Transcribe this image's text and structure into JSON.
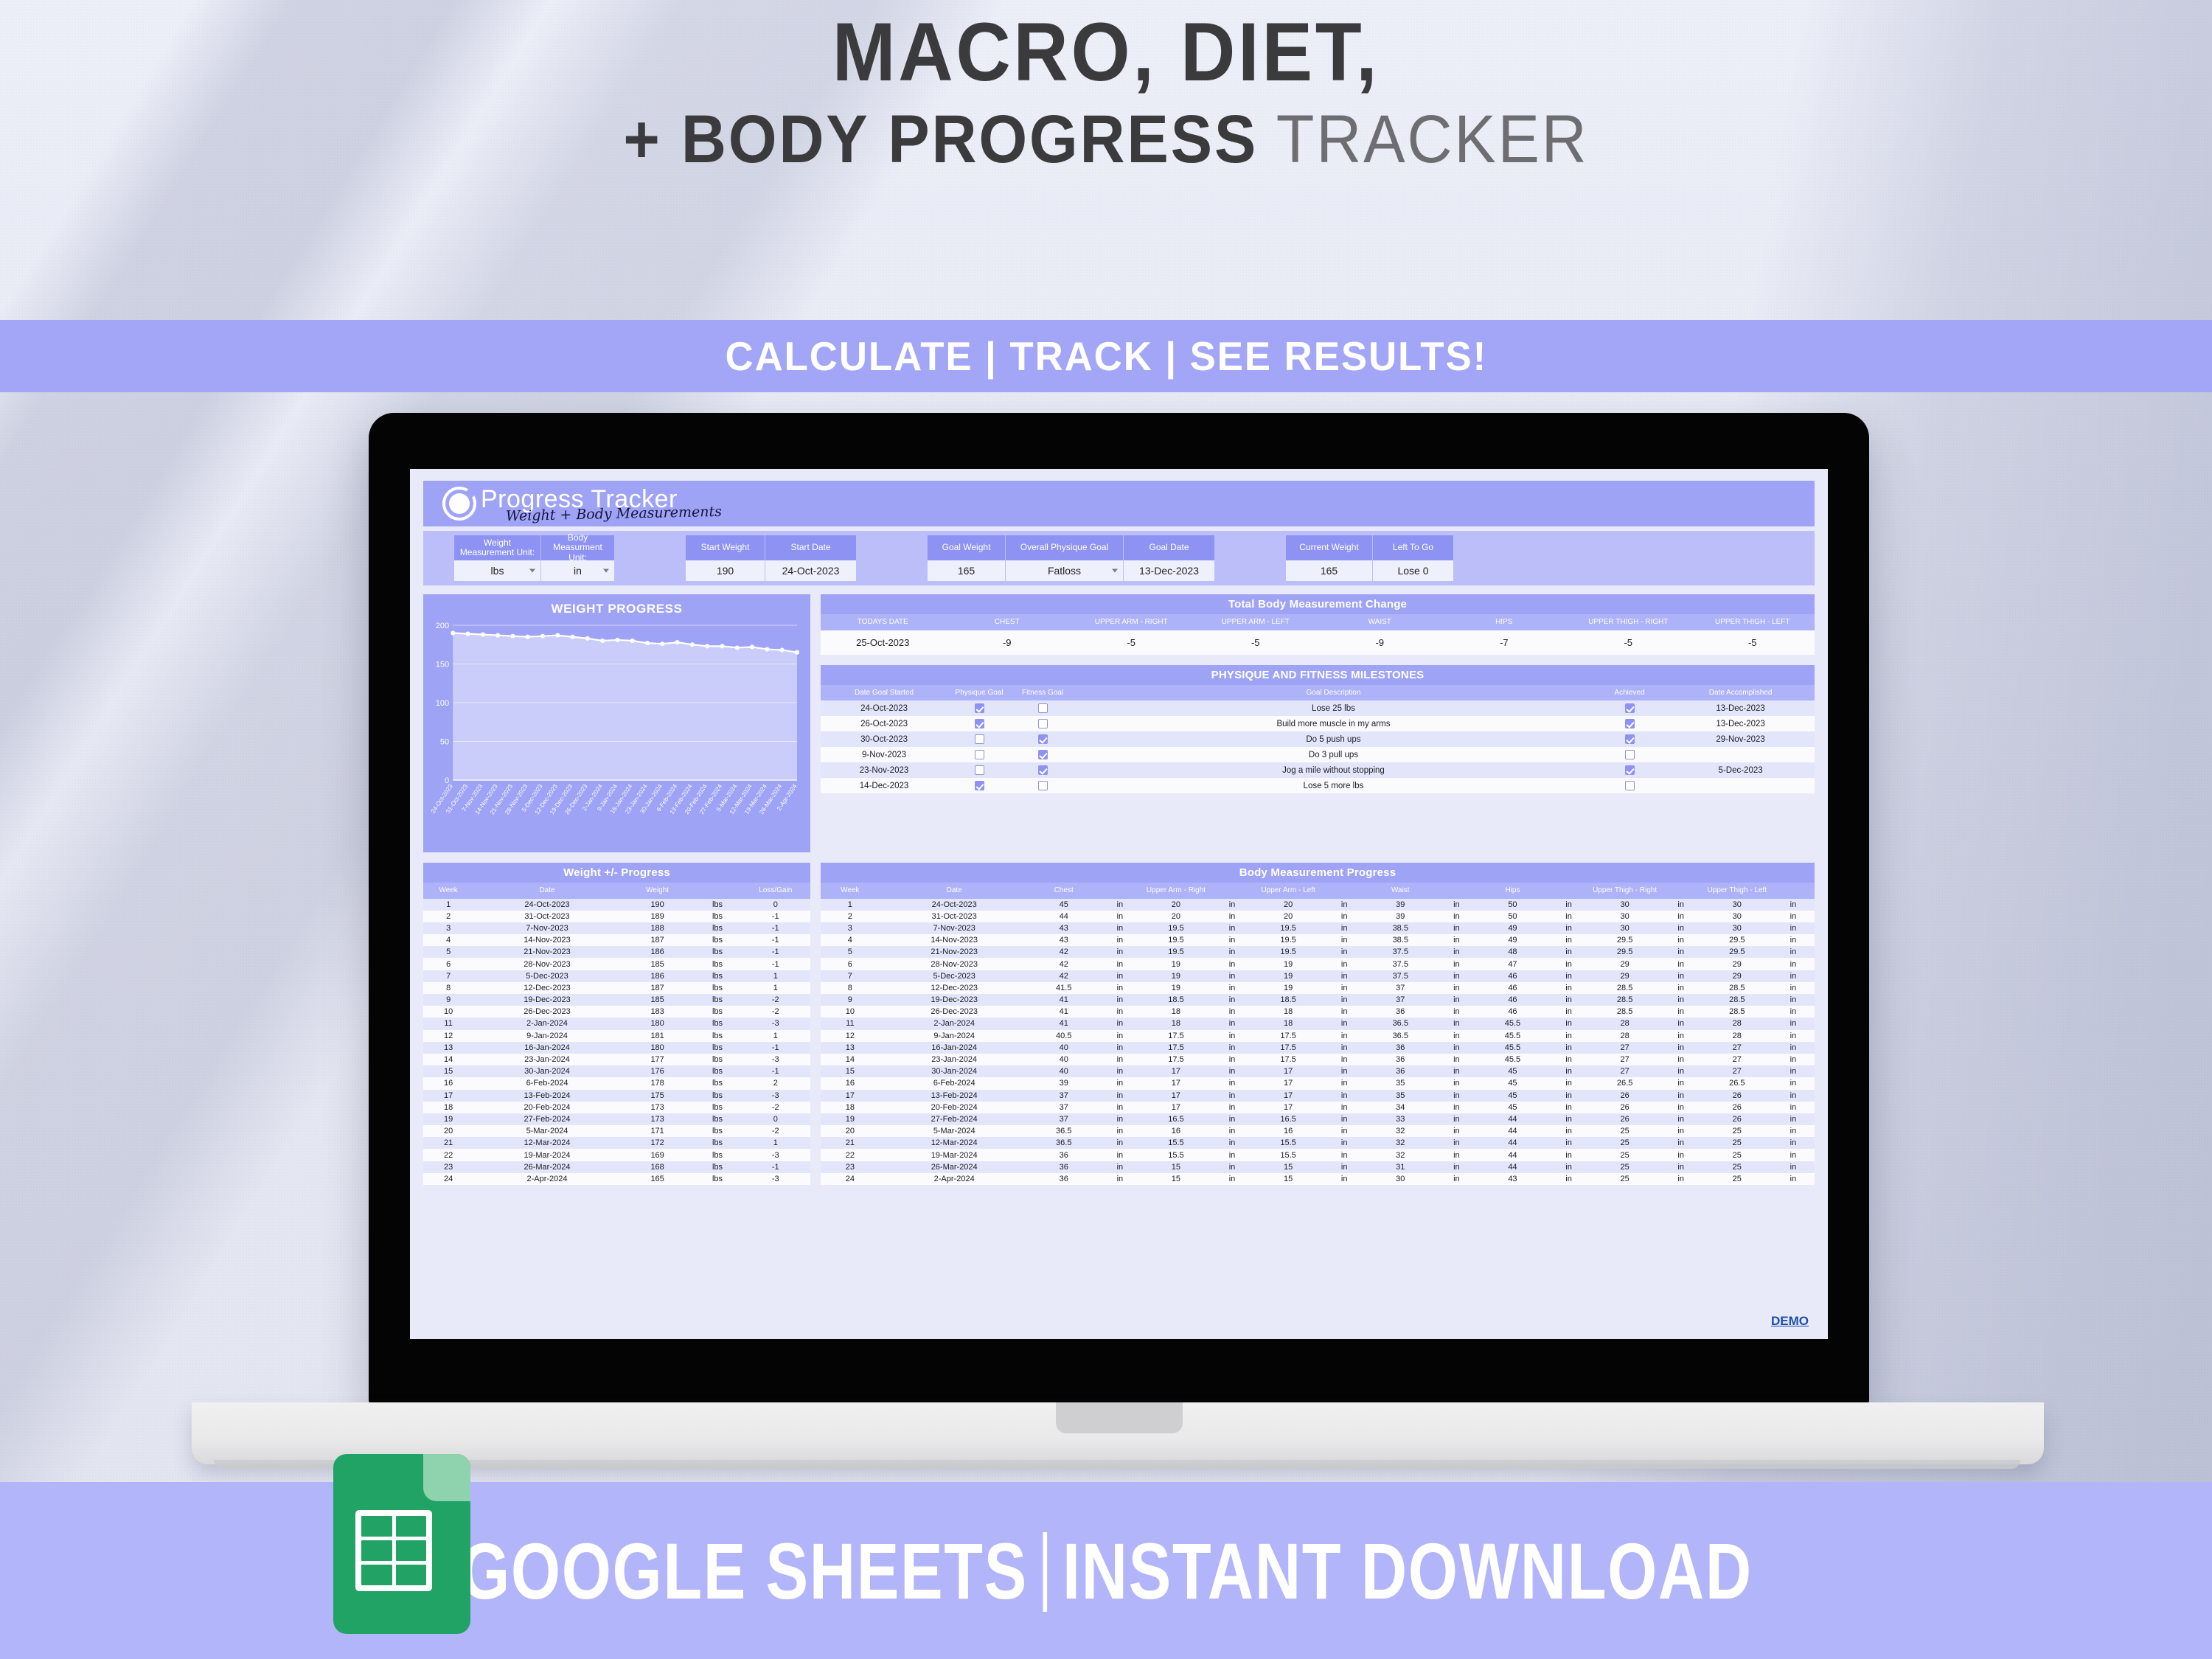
{
  "headline": {
    "line1": "MACRO, DIET,",
    "line2_bold": "+ BODY PROGRESS",
    "line2_light": "TRACKER"
  },
  "sub_banner": {
    "text": "CALCULATE | TRACK | SEE RESULTS!"
  },
  "bottom_banner": {
    "left": "GOOGLE SHEETS",
    "right": "INSTANT DOWNLOAD",
    "icon": "google-sheets-icon"
  },
  "colors": {
    "accent_purple": "#9fa3f6",
    "banner_purple": "#a3a5f7",
    "bottom_banner_purple": "#b3b5fa",
    "panel_bg": "#e8eaf9",
    "row_alt": "#e3e5fb",
    "sheets_green": "#21a366",
    "headline_dark": "#3b3b3d",
    "headline_light": "#6e6e72"
  },
  "sheet": {
    "brand": "Progress Tracker",
    "brand_sub": "Weight + Body Measurements",
    "demo_label": "DEMO",
    "controls": [
      {
        "cells": [
          {
            "header": "Weight Measurement Unit:",
            "value": "lbs",
            "dropdown": true,
            "w": 118
          },
          {
            "header": "Body Measurment Unit:",
            "value": "in",
            "dropdown": true,
            "w": 100
          }
        ]
      },
      {
        "cells": [
          {
            "header": "Start Weight",
            "value": "190",
            "dropdown": false,
            "w": 108
          },
          {
            "header": "Start Date",
            "value": "24-Oct-2023",
            "dropdown": false,
            "w": 124
          }
        ]
      },
      {
        "cells": [
          {
            "header": "Goal Weight",
            "value": "165",
            "dropdown": false,
            "w": 106
          },
          {
            "header": "Overall Physique Goal",
            "value": "Fatloss",
            "dropdown": true,
            "w": 160
          },
          {
            "header": "Goal Date",
            "value": "13-Dec-2023",
            "dropdown": false,
            "w": 124
          }
        ]
      },
      {
        "cells": [
          {
            "header": "Current Weight",
            "value": "165",
            "dropdown": false,
            "w": 118
          },
          {
            "header": "Left To Go",
            "value": "Lose 0",
            "dropdown": false,
            "w": 110
          }
        ]
      }
    ],
    "total_change": {
      "title": "Total Body Measurement Change",
      "headers": [
        "TODAYS DATE",
        "CHEST",
        "UPPER ARM - RIGHT",
        "UPPER ARM - LEFT",
        "WAIST",
        "HIPS",
        "UPPER THIGH - RIGHT",
        "UPPER THIGH - LEFT"
      ],
      "row": [
        "25-Oct-2023",
        "-9",
        "-5",
        "-5",
        "-9",
        "-7",
        "-5",
        "-5"
      ]
    },
    "milestones": {
      "title": "PHYSIQUE AND FITNESS MILESTONES",
      "headers": [
        "Date Goal Started",
        "Physique Goal",
        "Fitness Goal",
        "Goal Description",
        "Achieved",
        "Date Accomplished"
      ],
      "rows": [
        {
          "date_started": "24-Oct-2023",
          "physique": true,
          "fitness": false,
          "description": "Lose 25 lbs",
          "achieved": true,
          "date_accomplished": "13-Dec-2023"
        },
        {
          "date_started": "26-Oct-2023",
          "physique": true,
          "fitness": false,
          "description": "Build more muscle in my arms",
          "achieved": true,
          "date_accomplished": "13-Dec-2023"
        },
        {
          "date_started": "30-Oct-2023",
          "physique": false,
          "fitness": true,
          "description": "Do 5 push ups",
          "achieved": true,
          "date_accomplished": "29-Nov-2023"
        },
        {
          "date_started": "9-Nov-2023",
          "physique": false,
          "fitness": true,
          "description": "Do 3 pull ups",
          "achieved": false,
          "date_accomplished": ""
        },
        {
          "date_started": "23-Nov-2023",
          "physique": false,
          "fitness": true,
          "description": "Jog a mile without stopping",
          "achieved": true,
          "date_accomplished": "5-Dec-2023"
        },
        {
          "date_started": "14-Dec-2023",
          "physique": true,
          "fitness": false,
          "description": "Lose 5 more lbs",
          "achieved": false,
          "date_accomplished": ""
        }
      ]
    },
    "weight_progress_table": {
      "title": "Weight +/- Progress",
      "headers": [
        "Week",
        "Date",
        "Weight",
        "",
        "Loss/Gain"
      ],
      "rows": [
        [
          "1",
          "24-Oct-2023",
          "190",
          "lbs",
          "0"
        ],
        [
          "2",
          "31-Oct-2023",
          "189",
          "lbs",
          "-1"
        ],
        [
          "3",
          "7-Nov-2023",
          "188",
          "lbs",
          "-1"
        ],
        [
          "4",
          "14-Nov-2023",
          "187",
          "lbs",
          "-1"
        ],
        [
          "5",
          "21-Nov-2023",
          "186",
          "lbs",
          "-1"
        ],
        [
          "6",
          "28-Nov-2023",
          "185",
          "lbs",
          "-1"
        ],
        [
          "7",
          "5-Dec-2023",
          "186",
          "lbs",
          "1"
        ],
        [
          "8",
          "12-Dec-2023",
          "187",
          "lbs",
          "1"
        ],
        [
          "9",
          "19-Dec-2023",
          "185",
          "lbs",
          "-2"
        ],
        [
          "10",
          "26-Dec-2023",
          "183",
          "lbs",
          "-2"
        ],
        [
          "11",
          "2-Jan-2024",
          "180",
          "lbs",
          "-3"
        ],
        [
          "12",
          "9-Jan-2024",
          "181",
          "lbs",
          "1"
        ],
        [
          "13",
          "16-Jan-2024",
          "180",
          "lbs",
          "-1"
        ],
        [
          "14",
          "23-Jan-2024",
          "177",
          "lbs",
          "-3"
        ],
        [
          "15",
          "30-Jan-2024",
          "176",
          "lbs",
          "-1"
        ],
        [
          "16",
          "6-Feb-2024",
          "178",
          "lbs",
          "2"
        ],
        [
          "17",
          "13-Feb-2024",
          "175",
          "lbs",
          "-3"
        ],
        [
          "18",
          "20-Feb-2024",
          "173",
          "lbs",
          "-2"
        ],
        [
          "19",
          "27-Feb-2024",
          "173",
          "lbs",
          "0"
        ],
        [
          "20",
          "5-Mar-2024",
          "171",
          "lbs",
          "-2"
        ],
        [
          "21",
          "12-Mar-2024",
          "172",
          "lbs",
          "1"
        ],
        [
          "22",
          "19-Mar-2024",
          "169",
          "lbs",
          "-3"
        ],
        [
          "23",
          "26-Mar-2024",
          "168",
          "lbs",
          "-1"
        ],
        [
          "24",
          "2-Apr-2024",
          "165",
          "lbs",
          "-3"
        ]
      ]
    },
    "body_measurement_table": {
      "title": "Body Measurement Progress",
      "headers": [
        "Week",
        "Date",
        "Chest",
        "",
        "Upper Arm - Right",
        "",
        "Upper Arm - Left",
        "",
        "Waist",
        "",
        "Hips",
        "",
        "Upper Thigh - Right",
        "",
        "Upper Thigh - Left",
        ""
      ],
      "rows": [
        [
          "1",
          "24-Oct-2023",
          "45",
          "in",
          "20",
          "in",
          "20",
          "in",
          "39",
          "in",
          "50",
          "in",
          "30",
          "in",
          "30",
          "in"
        ],
        [
          "2",
          "31-Oct-2023",
          "44",
          "in",
          "20",
          "in",
          "20",
          "in",
          "39",
          "in",
          "50",
          "in",
          "30",
          "in",
          "30",
          "in"
        ],
        [
          "3",
          "7-Nov-2023",
          "43",
          "in",
          "19.5",
          "in",
          "19.5",
          "in",
          "38.5",
          "in",
          "49",
          "in",
          "30",
          "in",
          "30",
          "in"
        ],
        [
          "4",
          "14-Nov-2023",
          "43",
          "in",
          "19.5",
          "in",
          "19.5",
          "in",
          "38.5",
          "in",
          "49",
          "in",
          "29.5",
          "in",
          "29.5",
          "in"
        ],
        [
          "5",
          "21-Nov-2023",
          "42",
          "in",
          "19.5",
          "in",
          "19.5",
          "in",
          "37.5",
          "in",
          "48",
          "in",
          "29.5",
          "in",
          "29.5",
          "in"
        ],
        [
          "6",
          "28-Nov-2023",
          "42",
          "in",
          "19",
          "in",
          "19",
          "in",
          "37.5",
          "in",
          "47",
          "in",
          "29",
          "in",
          "29",
          "in"
        ],
        [
          "7",
          "5-Dec-2023",
          "42",
          "in",
          "19",
          "in",
          "19",
          "in",
          "37.5",
          "in",
          "46",
          "in",
          "29",
          "in",
          "29",
          "in"
        ],
        [
          "8",
          "12-Dec-2023",
          "41.5",
          "in",
          "19",
          "in",
          "19",
          "in",
          "37",
          "in",
          "46",
          "in",
          "28.5",
          "in",
          "28.5",
          "in"
        ],
        [
          "9",
          "19-Dec-2023",
          "41",
          "in",
          "18.5",
          "in",
          "18.5",
          "in",
          "37",
          "in",
          "46",
          "in",
          "28.5",
          "in",
          "28.5",
          "in"
        ],
        [
          "10",
          "26-Dec-2023",
          "41",
          "in",
          "18",
          "in",
          "18",
          "in",
          "36",
          "in",
          "46",
          "in",
          "28.5",
          "in",
          "28.5",
          "in"
        ],
        [
          "11",
          "2-Jan-2024",
          "41",
          "in",
          "18",
          "in",
          "18",
          "in",
          "36.5",
          "in",
          "45.5",
          "in",
          "28",
          "in",
          "28",
          "in"
        ],
        [
          "12",
          "9-Jan-2024",
          "40.5",
          "in",
          "17.5",
          "in",
          "17.5",
          "in",
          "36.5",
          "in",
          "45.5",
          "in",
          "28",
          "in",
          "28",
          "in"
        ],
        [
          "13",
          "16-Jan-2024",
          "40",
          "in",
          "17.5",
          "in",
          "17.5",
          "in",
          "36",
          "in",
          "45.5",
          "in",
          "27",
          "in",
          "27",
          "in"
        ],
        [
          "14",
          "23-Jan-2024",
          "40",
          "in",
          "17.5",
          "in",
          "17.5",
          "in",
          "36",
          "in",
          "45.5",
          "in",
          "27",
          "in",
          "27",
          "in"
        ],
        [
          "15",
          "30-Jan-2024",
          "40",
          "in",
          "17",
          "in",
          "17",
          "in",
          "36",
          "in",
          "45",
          "in",
          "27",
          "in",
          "27",
          "in"
        ],
        [
          "16",
          "6-Feb-2024",
          "39",
          "in",
          "17",
          "in",
          "17",
          "in",
          "35",
          "in",
          "45",
          "in",
          "26.5",
          "in",
          "26.5",
          "in"
        ],
        [
          "17",
          "13-Feb-2024",
          "37",
          "in",
          "17",
          "in",
          "17",
          "in",
          "35",
          "in",
          "45",
          "in",
          "26",
          "in",
          "26",
          "in"
        ],
        [
          "18",
          "20-Feb-2024",
          "37",
          "in",
          "17",
          "in",
          "17",
          "in",
          "34",
          "in",
          "45",
          "in",
          "26",
          "in",
          "26",
          "in"
        ],
        [
          "19",
          "27-Feb-2024",
          "37",
          "in",
          "16.5",
          "in",
          "16.5",
          "in",
          "33",
          "in",
          "44",
          "in",
          "26",
          "in",
          "26",
          "in"
        ],
        [
          "20",
          "5-Mar-2024",
          "36.5",
          "in",
          "16",
          "in",
          "16",
          "in",
          "32",
          "in",
          "44",
          "in",
          "25",
          "in",
          "25",
          "in"
        ],
        [
          "21",
          "12-Mar-2024",
          "36.5",
          "in",
          "15.5",
          "in",
          "15.5",
          "in",
          "32",
          "in",
          "44",
          "in",
          "25",
          "in",
          "25",
          "in"
        ],
        [
          "22",
          "19-Mar-2024",
          "36",
          "in",
          "15.5",
          "in",
          "15.5",
          "in",
          "32",
          "in",
          "44",
          "in",
          "25",
          "in",
          "25",
          "in"
        ],
        [
          "23",
          "26-Mar-2024",
          "36",
          "in",
          "15",
          "in",
          "15",
          "in",
          "31",
          "in",
          "44",
          "in",
          "25",
          "in",
          "25",
          "in"
        ],
        [
          "24",
          "2-Apr-2024",
          "36",
          "in",
          "15",
          "in",
          "15",
          "in",
          "30",
          "in",
          "43",
          "in",
          "25",
          "in",
          "25",
          "in"
        ]
      ]
    }
  },
  "chart_data": {
    "type": "area",
    "title": "WEIGHT PROGRESS",
    "xlabel": "",
    "ylabel": "",
    "ylim": [
      0,
      200
    ],
    "yticks": [
      0,
      50,
      100,
      150,
      200
    ],
    "grid": true,
    "legend": "none",
    "categories": [
      "24-Oct-2023",
      "31-Oct-2023",
      "7-Nov-2023",
      "14-Nov-2023",
      "21-Nov-2023",
      "28-Nov-2023",
      "5-Dec-2023",
      "12-Dec-2023",
      "19-Dec-2023",
      "26-Dec-2023",
      "2-Jan-2024",
      "9-Jan-2024",
      "16-Jan-2024",
      "23-Jan-2024",
      "30-Jan-2024",
      "6-Feb-2024",
      "13-Feb-2024",
      "20-Feb-2024",
      "27-Feb-2024",
      "5-Mar-2024",
      "12-Mar-2024",
      "19-Mar-2024",
      "26-Mar-2024",
      "2-Apr-2024"
    ],
    "series": [
      {
        "name": "Weight",
        "values": [
          190,
          189,
          188,
          187,
          186,
          185,
          186,
          187,
          185,
          183,
          180,
          181,
          180,
          177,
          176,
          178,
          175,
          173,
          173,
          171,
          172,
          169,
          168,
          165
        ]
      }
    ]
  }
}
